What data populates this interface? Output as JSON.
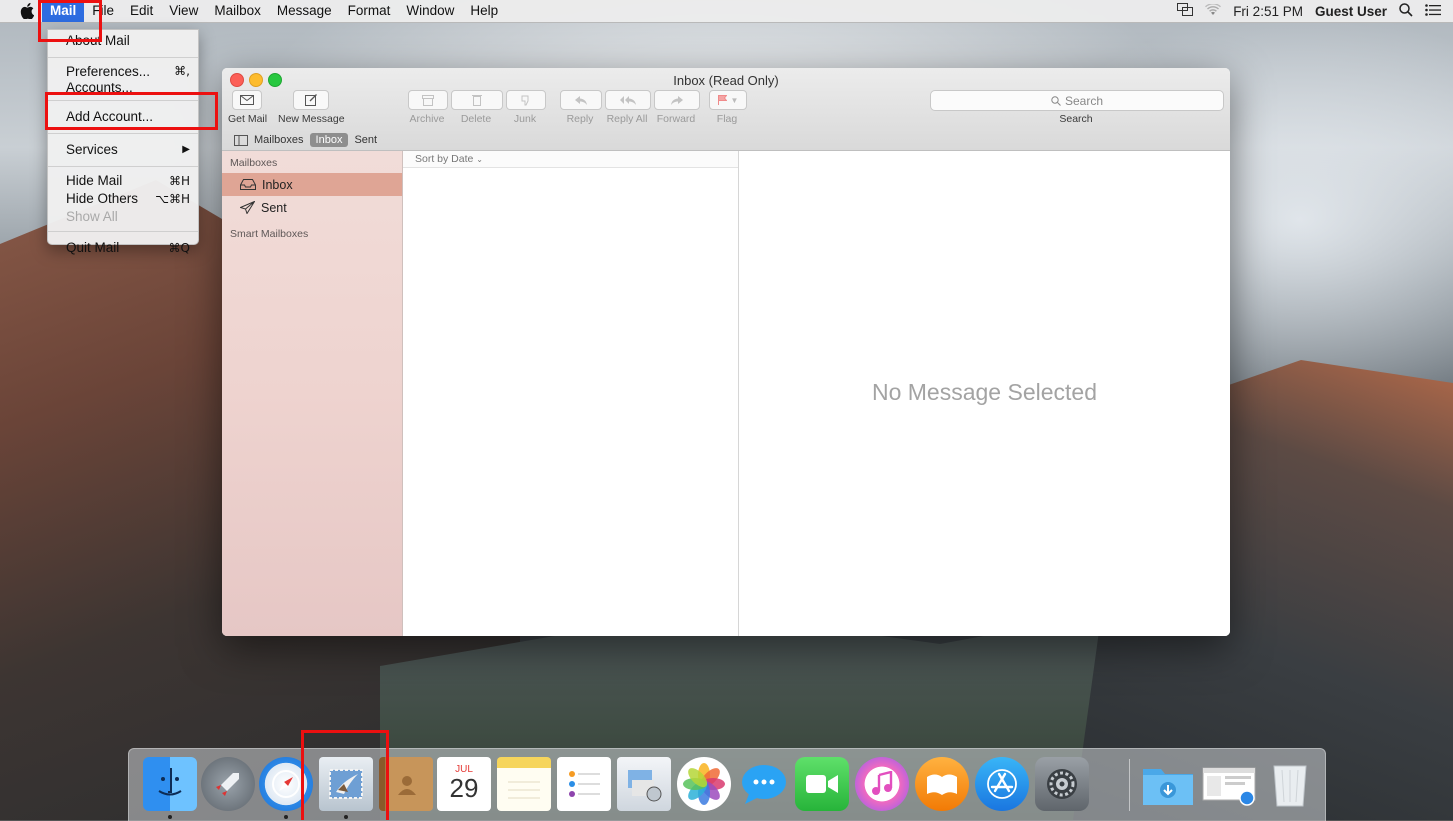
{
  "menubar": {
    "app_name": "Mail",
    "menus": [
      "File",
      "Edit",
      "View",
      "Mailbox",
      "Message",
      "Format",
      "Window",
      "Help"
    ],
    "clock": "Fri 2:51 PM",
    "user": "Guest User"
  },
  "app_menu": {
    "about": "About Mail",
    "preferences": "Preferences...",
    "preferences_shortcut": "⌘,",
    "accounts": "Accounts...",
    "add_account": "Add Account...",
    "services": "Services",
    "hide_mail": "Hide Mail",
    "hide_mail_shortcut": "⌘H",
    "hide_others": "Hide Others",
    "hide_others_shortcut": "⌥⌘H",
    "show_all": "Show All",
    "quit": "Quit Mail",
    "quit_shortcut": "⌘Q"
  },
  "window": {
    "title": "Inbox (Read Only)",
    "toolbar": {
      "get_mail": "Get Mail",
      "new_message": "New Message",
      "archive": "Archive",
      "delete": "Delete",
      "junk": "Junk",
      "reply": "Reply",
      "reply_all": "Reply All",
      "forward": "Forward",
      "flag": "Flag",
      "search_placeholder": "Search",
      "search_label": "Search"
    },
    "favorites": {
      "mailboxes": "Mailboxes",
      "inbox": "Inbox",
      "sent": "Sent"
    },
    "sidebar": {
      "header": "Mailboxes",
      "items": [
        {
          "label": "Inbox",
          "icon": "tray-icon",
          "selected": true
        },
        {
          "label": "Sent",
          "icon": "paper-plane-icon",
          "selected": false
        }
      ],
      "smart_header": "Smart Mailboxes"
    },
    "message_list": {
      "sort": "Sort by Date"
    },
    "viewer": {
      "empty_text": "No Message Selected"
    }
  },
  "dock": {
    "icons": [
      "finder-icon",
      "launchpad-icon",
      "safari-icon",
      "mail-icon",
      "contacts-icon",
      "calendar-icon",
      "notes-icon",
      "reminders-icon",
      "preview-icon",
      "photos-icon",
      "messages-icon",
      "facetime-icon",
      "itunes-icon",
      "ibooks-icon",
      "app-store-icon",
      "system-preferences-icon",
      "downloads-folder-icon",
      "screenshot-stack-icon",
      "trash-icon"
    ],
    "calendar_month": "JUL",
    "calendar_day": "29"
  },
  "colors": {
    "menu_highlight": "#2d6ce0",
    "annotation_red": "#ec1010",
    "sidebar_selection": "#dfa595"
  }
}
